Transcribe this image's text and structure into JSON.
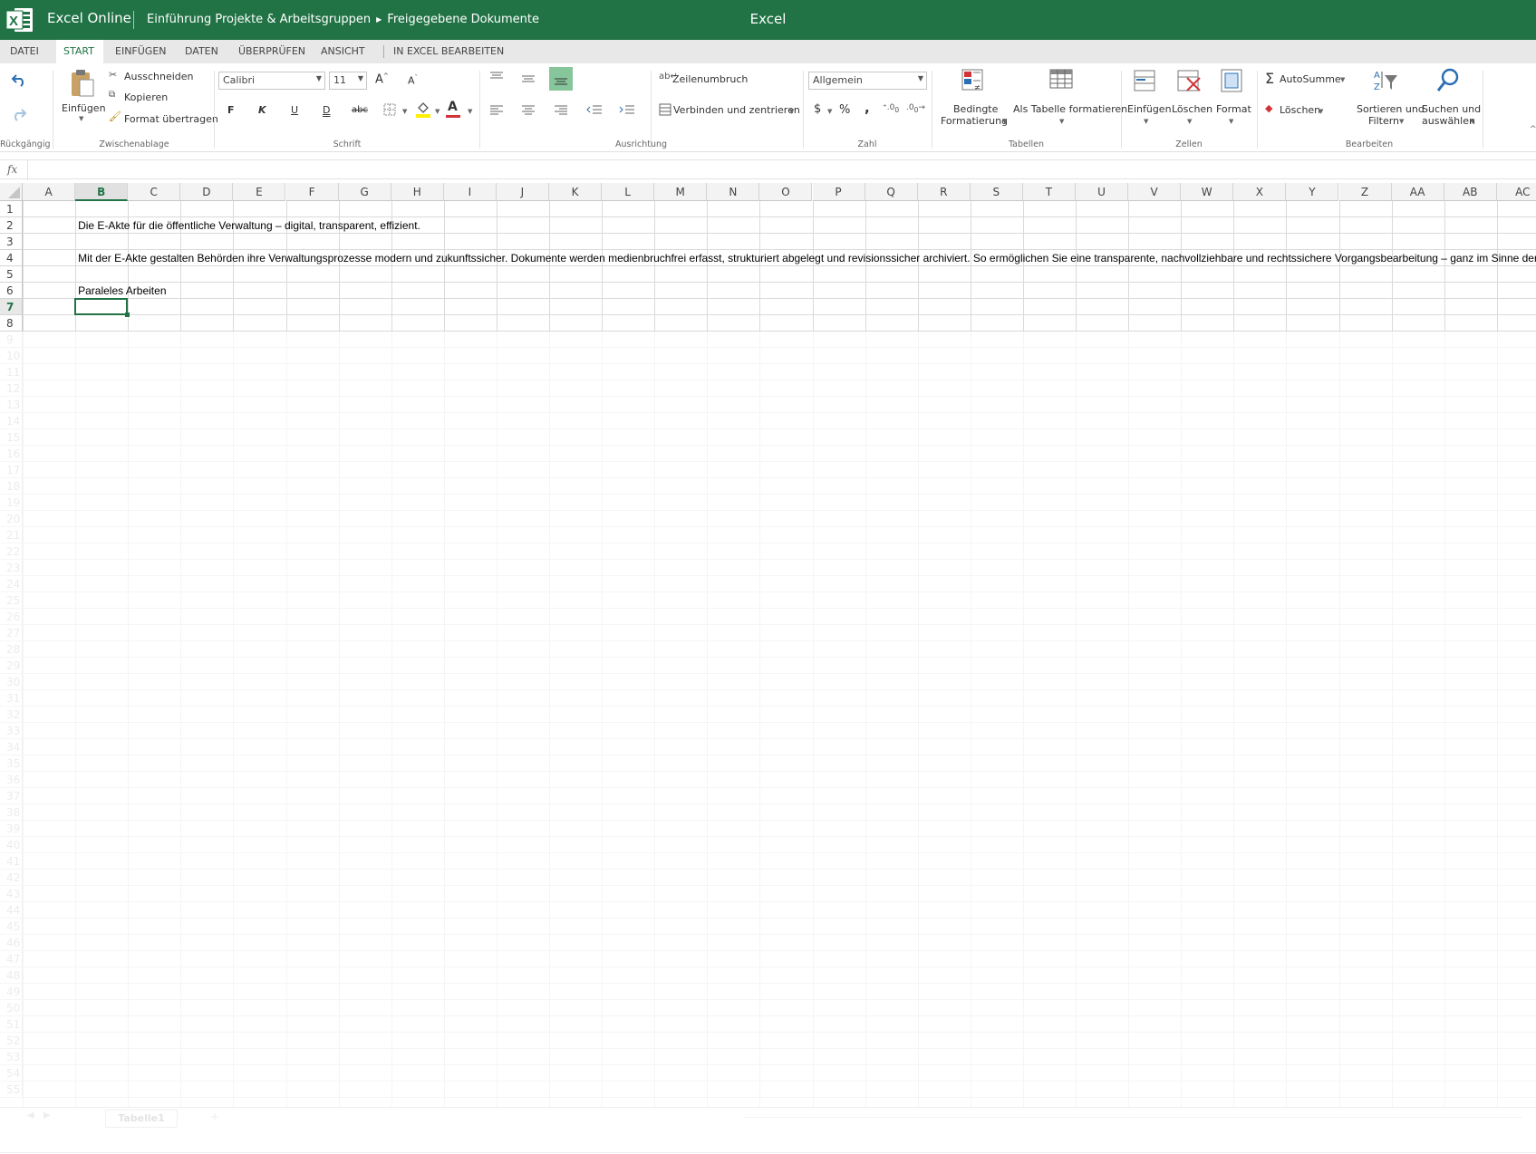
{
  "colors": {
    "brand": "#217346",
    "accent_green": "#86c69a",
    "font_red": "#d13438",
    "fill_yellow": "#ffef00"
  },
  "titlebar": {
    "app_name": "Excel Online",
    "breadcrumb": [
      "Einführung Projekte & Arbeitsgruppen",
      "Freigegebene Dokumente"
    ],
    "center_title": "Excel"
  },
  "tabs": [
    {
      "label": "DATEI"
    },
    {
      "label": "START",
      "active": true
    },
    {
      "label": "EINFÜGEN"
    },
    {
      "label": "DATEN"
    },
    {
      "label": "ÜBERPRÜFEN"
    },
    {
      "label": "ANSICHT"
    },
    {
      "label": "IN EXCEL BEARBEITEN"
    }
  ],
  "ribbon": {
    "undo_group": {
      "label": "Rückgängig",
      "undo_icon": "undo-icon",
      "redo_icon": "redo-icon"
    },
    "clipboard": {
      "label": "Zwischenablage",
      "paste": "Einfügen",
      "cut": "Ausschneiden",
      "copy": "Kopieren",
      "format_painter": "Format übertragen"
    },
    "font": {
      "label": "Schrift",
      "font_name": "Calibri",
      "font_size": "11",
      "bold": "F",
      "italic": "K",
      "underline": "U",
      "double_underline": "D",
      "strike": "abc",
      "font_color_letter": "A"
    },
    "alignment": {
      "label": "Ausrichtung",
      "wrap": "Zeilenumbruch",
      "merge": "Verbinden und zentrieren"
    },
    "number": {
      "label": "Zahl",
      "format": "Allgemein",
      "currency": "$",
      "percent": "%",
      "comma": ","
    },
    "tables": {
      "label": "Tabellen",
      "conditional_line1": "Bedingte",
      "conditional_line2": "Formatierung",
      "as_table": "Als Tabelle formatieren"
    },
    "cells": {
      "label": "Zellen",
      "insert": "Einfügen",
      "delete": "Löschen",
      "format": "Format"
    },
    "editing": {
      "label": "Bearbeiten",
      "autosum": "AutoSumme",
      "clear": "Löschen",
      "sort_line1": "Sortieren und",
      "sort_line2": "Filtern",
      "find_line1": "Suchen und",
      "find_line2": "auswählen"
    }
  },
  "formula_bar": {
    "fx": "fx",
    "value": ""
  },
  "grid": {
    "columns": [
      "A",
      "B",
      "C",
      "D",
      "E",
      "F",
      "G",
      "H",
      "I",
      "J",
      "K",
      "L",
      "M",
      "N",
      "O",
      "P",
      "Q",
      "R",
      "S",
      "T",
      "U",
      "V",
      "W",
      "X",
      "Y",
      "Z",
      "AA",
      "AB",
      "AC"
    ],
    "selected_column": "B",
    "rows": [
      "1",
      "2",
      "3",
      "4",
      "5",
      "6",
      "7",
      "8",
      "9",
      "10",
      "11",
      "12",
      "13",
      "14",
      "15",
      "16",
      "17",
      "18",
      "19",
      "20",
      "21",
      "22",
      "23",
      "24",
      "25",
      "26",
      "27",
      "28",
      "29",
      "30",
      "31",
      "32",
      "33",
      "34",
      "35",
      "36",
      "37",
      "38",
      "39",
      "40",
      "41",
      "42",
      "43",
      "44",
      "45",
      "46",
      "47",
      "48",
      "49",
      "50",
      "51",
      "52",
      "53",
      "54",
      "55"
    ],
    "selected_row": "7",
    "cells": {
      "B2": "Die E-Akte für die öffentliche Verwaltung – digital, transparent, effizient.",
      "B4": "Mit der E-Akte gestalten Behörden ihre Verwaltungsprozesse modern und zukunftssicher. Dokumente werden medienbruchfrei erfasst, strukturiert abgelegt und revisionssicher archiviert. So ermöglichen Sie eine transparente, nachvollziehbare und rechtssichere Vorgangsbearbeitung – ganz im Sinne der digitalen Verwaltung.",
      "B6": "Paraleles Arbeiten"
    }
  },
  "sheets": {
    "tabs": [
      "Tabelle1"
    ],
    "add": "+"
  }
}
